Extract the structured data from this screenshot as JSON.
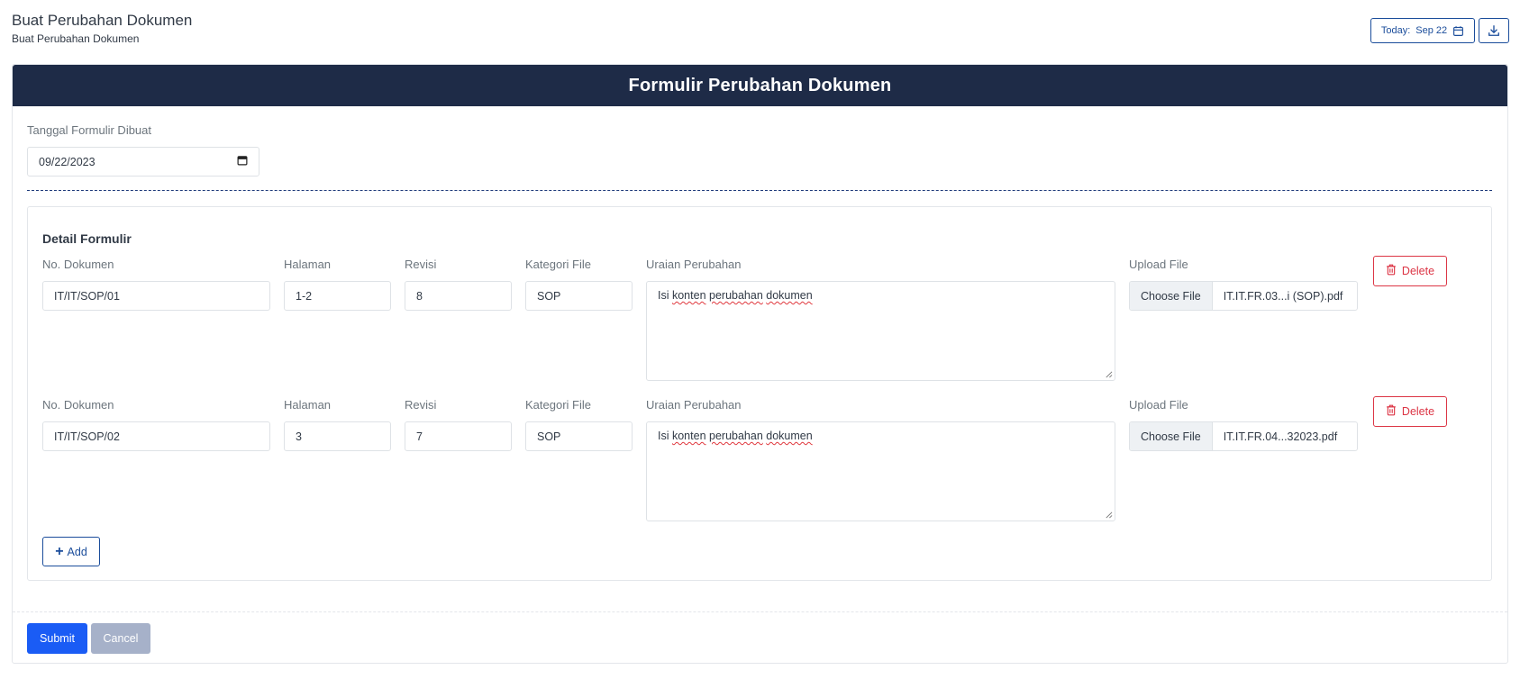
{
  "header": {
    "title": "Buat Perubahan Dokumen",
    "subtitle": "Buat Perubahan Dokumen",
    "today_label": "Today:",
    "today_value": "Sep 22"
  },
  "form": {
    "title": "Formulir Perubahan Dokumen",
    "date_label": "Tanggal Formulir Dibuat",
    "date_value": "09/22/2023"
  },
  "detail": {
    "title": "Detail Formulir",
    "labels": {
      "no_dokumen": "No. Dokumen",
      "halaman": "Halaman",
      "revisi": "Revisi",
      "kategori": "Kategori File",
      "uraian": "Uraian Perubahan",
      "upload": "Upload File"
    },
    "rows": [
      {
        "no_dokumen": "IT/IT/SOP/01",
        "halaman": "1-2",
        "revisi": "8",
        "kategori": "SOP",
        "uraian_1": "Isi",
        "uraian_2": "konten",
        "uraian_3": "perubahan",
        "uraian_4": "dokumen",
        "choose_label": "Choose File",
        "file_name": "IT.IT.FR.03...i (SOP).pdf",
        "delete_label": "Delete"
      },
      {
        "no_dokumen": "IT/IT/SOP/02",
        "halaman": "3",
        "revisi": "7",
        "kategori": "SOP",
        "uraian_1": "Isi",
        "uraian_2": "konten",
        "uraian_3": "perubahan",
        "uraian_4": "dokumen",
        "choose_label": "Choose File",
        "file_name": "IT.IT.FR.04...32023.pdf",
        "delete_label": "Delete"
      }
    ],
    "add_label": "Add"
  },
  "actions": {
    "submit_label": "Submit",
    "cancel_label": "Cancel"
  },
  "colors": {
    "header_bg": "#1e2b47",
    "primary": "#1a5cf5",
    "danger": "#dc3545",
    "outline": "#1b4d9b",
    "disabled": "#a6b1c9"
  },
  "icons": [
    "calendar-icon",
    "download-icon",
    "trash-icon",
    "plus-icon",
    "date-picker-icon",
    "resize-grip-icon"
  ]
}
